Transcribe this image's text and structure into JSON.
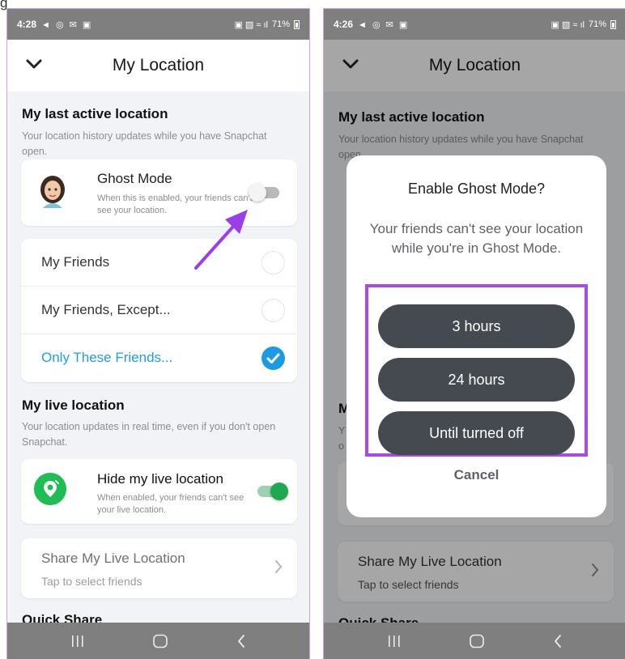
{
  "corner_letter": "g",
  "phones": [
    {
      "status_bar": {
        "time": "4:28",
        "left_icons": "◄ ◎ ✉ ▣",
        "right_icons": "▣ ▧ ≈ ıl",
        "battery": "71%"
      },
      "header": {
        "title": "My Location"
      },
      "last_active": {
        "title": "My last active location",
        "desc": "Your location history updates while you have Snapchat open."
      },
      "ghost": {
        "title": "Ghost Mode",
        "desc": "When this is enabled, your friends can't see your location.",
        "enabled": false
      },
      "friends_options": [
        {
          "label": "My Friends",
          "selected": false
        },
        {
          "label": "My Friends, Except...",
          "selected": false
        },
        {
          "label": "Only These Friends...",
          "selected": true
        }
      ],
      "live": {
        "title": "My live location",
        "desc": "Your location updates in real time, even if you don't open Snapchat."
      },
      "hide_live": {
        "title": "Hide my live location",
        "desc": "When enabled, your friends can't see your live location.",
        "enabled": true
      },
      "share": {
        "title": "Share My Live Location",
        "subtitle": "Tap to select friends"
      },
      "quick_share": "Quick Share"
    },
    {
      "status_bar": {
        "time": "4:26",
        "left_icons": "◄ ◎ ✉ ▣",
        "right_icons": "▣ ▧ ≈ ıl",
        "battery": "71%"
      },
      "header": {
        "title": "My Location"
      },
      "last_active": {
        "title": "My last active location",
        "desc": "Your location history updates while you have Snapchat open."
      },
      "live_partial": {
        "title": "M",
        "desc": "Y\no"
      },
      "share": {
        "title": "Share My Live Location",
        "subtitle": "Tap to select friends"
      },
      "quick_share": "Quick Share",
      "dialog": {
        "title": "Enable Ghost Mode?",
        "message": "Your friends can't see your location while you're in Ghost Mode.",
        "options": [
          "3 hours",
          "24 hours",
          "Until turned off"
        ],
        "cancel": "Cancel"
      }
    }
  ],
  "colors": {
    "accent_blue": "#1d9ae4",
    "green": "#1fbd54",
    "highlight": "#a84be0",
    "pill": "#454a50",
    "system_bar": "#7f7f7f"
  },
  "icons": {
    "back": "chevron-down-icon",
    "nav": [
      "recents-icon",
      "home-icon",
      "back-icon"
    ]
  }
}
